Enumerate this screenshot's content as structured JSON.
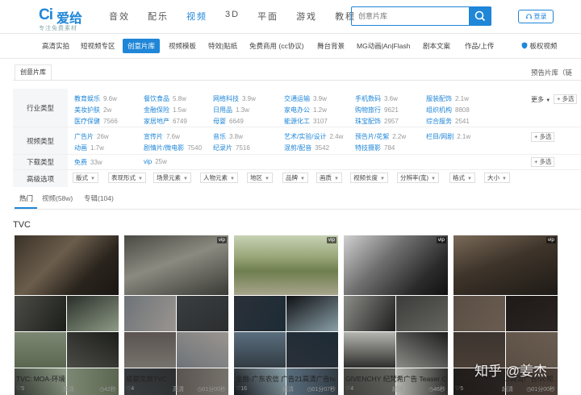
{
  "colors": {
    "accent": "#1f86d8",
    "label_bg": "#f5f6f7"
  },
  "logo": {
    "mark": "Ci",
    "name": "爱给",
    "slogan": "专注免费素材"
  },
  "nav": [
    {
      "label": "音效"
    },
    {
      "label": "配乐"
    },
    {
      "label": "视频",
      "active": true
    },
    {
      "label": "3D"
    },
    {
      "label": "平面"
    },
    {
      "label": "游戏"
    },
    {
      "label": "教程"
    }
  ],
  "search": {
    "placeholder": "创意片库",
    "icon": "search-icon"
  },
  "login": {
    "label": "登录",
    "icon": "headset-icon"
  },
  "subnav": {
    "items": [
      {
        "label": "高清实拍"
      },
      {
        "label": "短视频专区"
      },
      {
        "label": "创意片库",
        "active": true
      },
      {
        "label": "视频模板"
      },
      {
        "label": "特效|贴纸"
      },
      {
        "label": "免费商用 (cc协议)"
      },
      {
        "label": "舞台背景"
      },
      {
        "label": "MG动画|An|Flash"
      },
      {
        "label": "剧本文案"
      },
      {
        "label": "作品/上传"
      }
    ],
    "right": "板权视频",
    "right_icon": "shield-icon"
  },
  "breadcrumb": "创意片库",
  "notice": "预告片库（链",
  "filters": {
    "industry": {
      "label": "行业类型",
      "items": [
        {
          "name": "教育娱乐",
          "count": "9.6w"
        },
        {
          "name": "餐饮食品",
          "count": "5.8w"
        },
        {
          "name": "网络科技",
          "count": "3.9w"
        },
        {
          "name": "交通运输",
          "count": "3.9w"
        },
        {
          "name": "手机数码",
          "count": "3.6w"
        },
        {
          "name": "服装配饰",
          "count": "2.1w"
        },
        {
          "name": "美妆护肤",
          "count": "2w"
        },
        {
          "name": "金融保险",
          "count": "1.5w"
        },
        {
          "name": "日用品",
          "count": "1.3w"
        },
        {
          "name": "家电办公",
          "count": "1.2w"
        },
        {
          "name": "购物旅行",
          "count": "9621"
        },
        {
          "name": "组织机构",
          "count": "8808"
        },
        {
          "name": "医疗保健",
          "count": "7566"
        },
        {
          "name": "家居地产",
          "count": "6749"
        },
        {
          "name": "母婴",
          "count": "6649"
        },
        {
          "name": "能源化工",
          "count": "3107"
        },
        {
          "name": "珠宝配饰",
          "count": "2957"
        },
        {
          "name": "综合服务",
          "count": "2541"
        }
      ],
      "more": "更多",
      "multi": "+ 多选"
    },
    "video": {
      "label": "视频类型",
      "items": [
        {
          "name": "广告片",
          "count": "26w"
        },
        {
          "name": "宣传片",
          "count": "7.6w"
        },
        {
          "name": "音乐",
          "count": "3.8w"
        },
        {
          "name": "艺术/实验/设计",
          "count": "2.4w"
        },
        {
          "name": "预告片/花絮",
          "count": "2.2w"
        },
        {
          "name": "栏目/网剧",
          "count": "2.1w"
        },
        {
          "name": "动画",
          "count": "1.7w"
        },
        {
          "name": "剧情片/微电影",
          "count": "7540"
        },
        {
          "name": "纪录片",
          "count": "7516"
        },
        {
          "name": "混剪/配音",
          "count": "3542"
        },
        {
          "name": "特技摄影",
          "count": "784"
        }
      ],
      "multi": "+ 多选"
    },
    "download": {
      "label": "下载类型",
      "items": [
        {
          "name": "免费",
          "count": "33w"
        },
        {
          "name": "vip",
          "count": "25w"
        }
      ],
      "multi": "+ 多选"
    },
    "advanced": {
      "label": "高级选项",
      "options": [
        "版式",
        "表现形式",
        "场景元素",
        "人物元素",
        "地区",
        "品牌",
        "画质",
        "视频长度",
        "分辨率(宽)",
        "格式",
        "大小"
      ]
    }
  },
  "tabs": [
    {
      "label": "热门",
      "active": true
    },
    {
      "label": "视频(58w)"
    },
    {
      "label": "专辑(104)"
    }
  ],
  "section_title": "TVC",
  "cards": [
    {
      "title": "TVC: MOA-环境",
      "likes": "5",
      "quality": "高清",
      "duration": "42秒",
      "vip": false
    },
    {
      "title": "成都文旅TVC",
      "likes": "4",
      "quality": "高清",
      "duration": "01分00秒",
      "vip": true
    },
    {
      "title": "金融-广东农信 广告21高清广告tv...",
      "likes": "16",
      "quality": "超清",
      "duration": "01分07秒",
      "vip": true
    },
    {
      "title": "GIVENCHY 纪梵希广告 Teaser C...",
      "likes": "4",
      "quality": "超清",
      "duration": "46秒",
      "vip": true
    },
    {
      "title": "地产 - 九洲海普12高清广告tvc视...",
      "likes": "5",
      "quality": "超清",
      "duration": "01分00秒",
      "vip": true
    }
  ],
  "watermark": "知乎 @姜杰"
}
